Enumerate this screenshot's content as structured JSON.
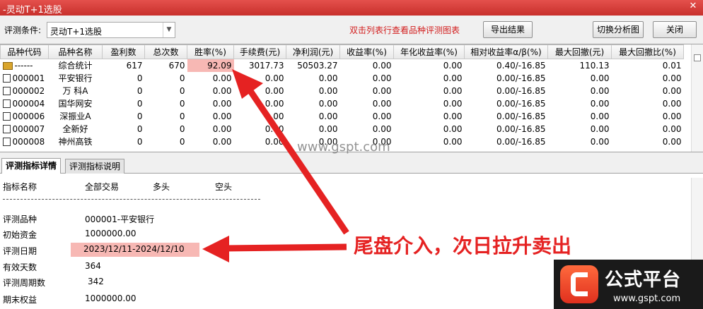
{
  "window": {
    "title": "-灵动T+1选股"
  },
  "toolbar": {
    "condition_label": "评测条件:",
    "condition_value": "灵动T+1选股",
    "hint": "双击列表行查看品种评测图表",
    "export_label": "导出结果",
    "switch_label": "切换分析图",
    "close_label": "关闭"
  },
  "table": {
    "columns": [
      "品种代码",
      "品种名称",
      "盈利数",
      "总次数",
      "胜率(%)",
      "手续费(元)",
      "净利润(元)",
      "收益率(%)",
      "年化收益率(%)",
      "相对收益率α/β(%)",
      "最大回撤(元)",
      "最大回撤比(%)"
    ],
    "rows": [
      [
        "------",
        "综合统计",
        "617",
        "670",
        "92.09",
        "3017.73",
        "50503.27",
        "0.00",
        "0.00",
        "0.40/-16.85",
        "110.13",
        "0.01"
      ],
      [
        "000001",
        "平安银行",
        "0",
        "0",
        "0.00",
        "0.00",
        "0.00",
        "0.00",
        "0.00",
        "0.00/-16.85",
        "0.00",
        "0.00"
      ],
      [
        "000002",
        "万 科A",
        "0",
        "0",
        "0.00",
        "0.00",
        "0.00",
        "0.00",
        "0.00",
        "0.00/-16.85",
        "0.00",
        "0.00"
      ],
      [
        "000004",
        "国华网安",
        "0",
        "0",
        "0.00",
        "0.00",
        "0.00",
        "0.00",
        "0.00",
        "0.00/-16.85",
        "0.00",
        "0.00"
      ],
      [
        "000006",
        "深振业A",
        "0",
        "0",
        "0.00",
        "0.00",
        "0.00",
        "0.00",
        "0.00",
        "0.00/-16.85",
        "0.00",
        "0.00"
      ],
      [
        "000007",
        "全新好",
        "0",
        "0",
        "0.00",
        "0.00",
        "0.00",
        "0.00",
        "0.00",
        "0.00/-16.85",
        "0.00",
        "0.00"
      ],
      [
        "000008",
        "神州高铁",
        "0",
        "0",
        "0.00",
        "0.00",
        "0.00",
        "0.00",
        "0.00",
        "0.00/-16.85",
        "0.00",
        "0.00"
      ]
    ]
  },
  "tabs": [
    "评测指标详情",
    "评测指标说明"
  ],
  "detail": {
    "headers": [
      "指标名称",
      "全部交易",
      "多头",
      "空头"
    ],
    "items": [
      {
        "label": "评测品种",
        "value": "000001-平安银行"
      },
      {
        "label": "初始资金",
        "value": "1000000.00"
      },
      {
        "label": "评测日期",
        "value": "2023/12/11-2024/12/10"
      },
      {
        "label": "有效天数",
        "value": "364"
      },
      {
        "label": "评测周期数",
        "value": "342"
      },
      {
        "label": "期末权益",
        "value": "1000000.00"
      }
    ]
  },
  "annotation": "尾盘介入，次日拉升卖出",
  "watermark": {
    "site": "www.gspt.com"
  },
  "logo": {
    "brand": "公式平台",
    "url": "www.gspt.com"
  },
  "colors": {
    "titlebar": "#d9403c",
    "highlight": "#f7b8b4",
    "hint": "#d21e1e",
    "annotation": "#e52222"
  }
}
